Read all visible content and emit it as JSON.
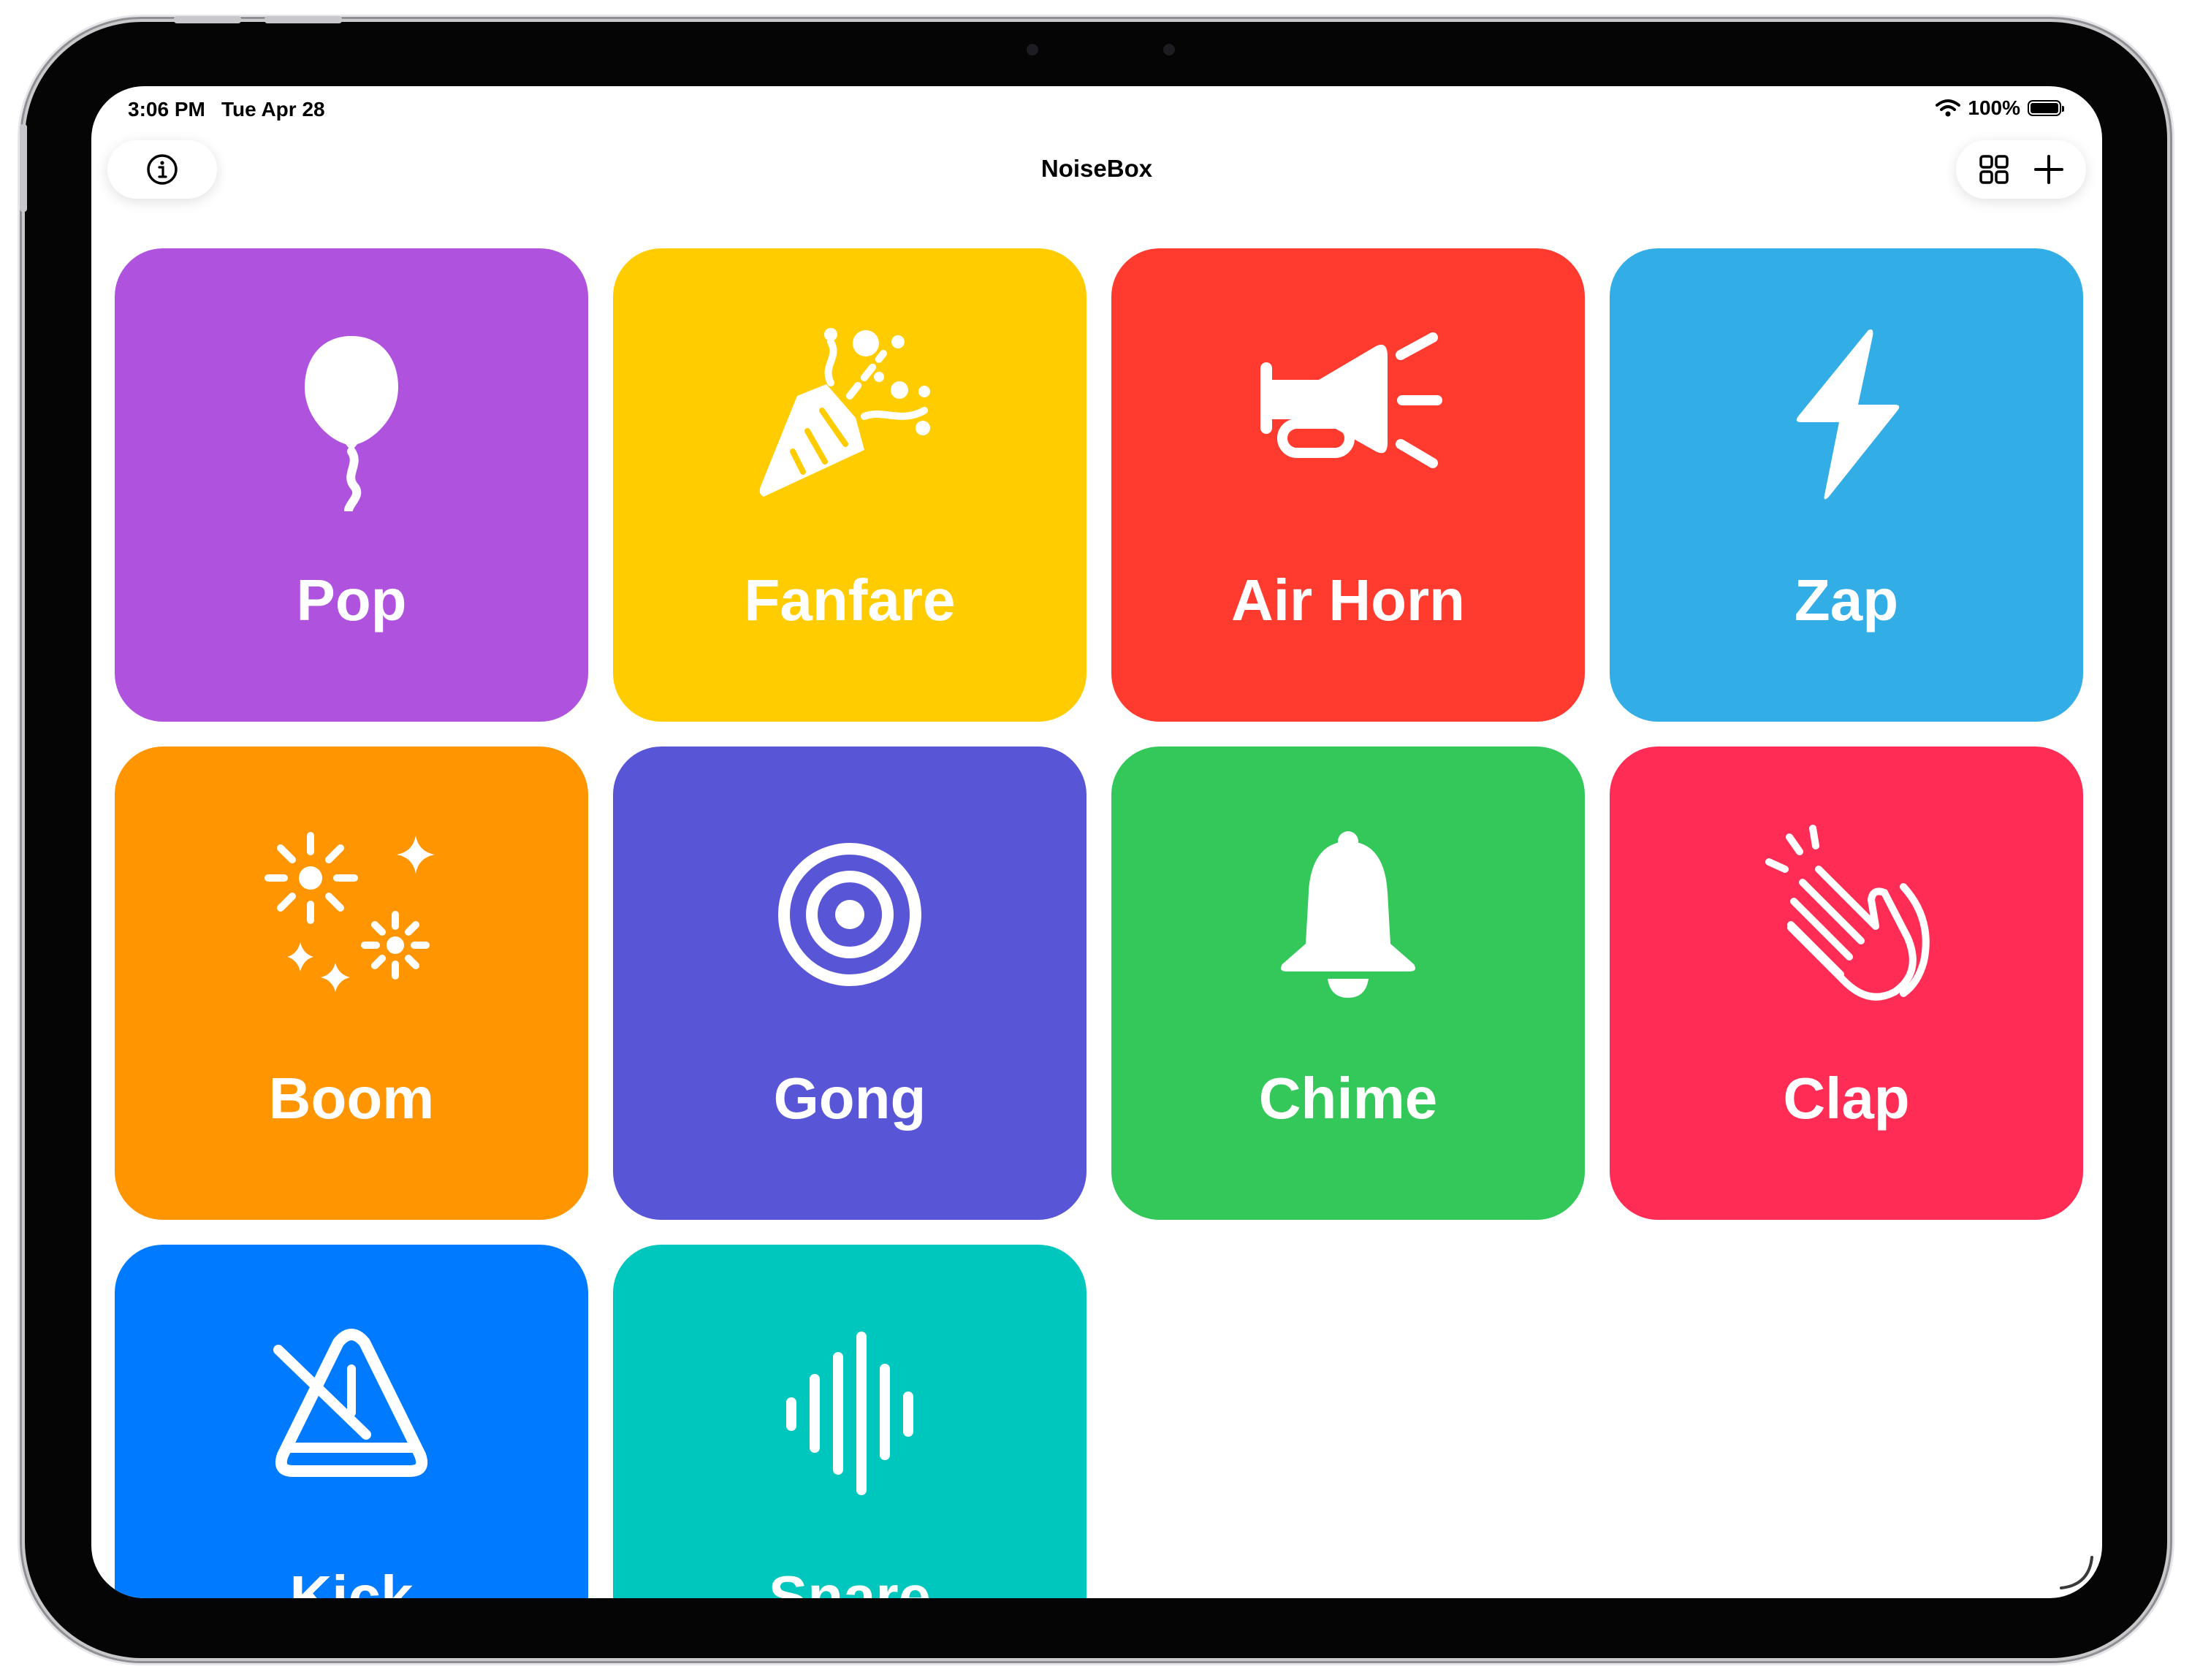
{
  "status_bar": {
    "time": "3:06 PM",
    "date": "Tue Apr 28",
    "battery": "100%",
    "battery_level": 1.0
  },
  "nav": {
    "title": "NoiseBox",
    "left_icon": "info-circle-icon",
    "right_icons": [
      "grid-icon",
      "plus-icon"
    ]
  },
  "tiles": [
    {
      "label": "Pop",
      "color": "#AF52DE",
      "icon": "balloon-icon"
    },
    {
      "label": "Fanfare",
      "color": "#FFCC00",
      "icon": "party-popper-icon"
    },
    {
      "label": "Air Horn",
      "color": "#FF3B30",
      "icon": "horn-icon"
    },
    {
      "label": "Zap",
      "color": "#32ADE6",
      "icon": "bolt-icon"
    },
    {
      "label": "Boom",
      "color": "#FF9500",
      "icon": "fireworks-icon"
    },
    {
      "label": "Gong",
      "color": "#5856D6",
      "icon": "target-icon"
    },
    {
      "label": "Chime",
      "color": "#34C759",
      "icon": "bell-icon"
    },
    {
      "label": "Clap",
      "color": "#FF2D55",
      "icon": "hands-clap-icon"
    },
    {
      "label": "Kick",
      "color": "#007AFF",
      "icon": "metronome-icon"
    },
    {
      "label": "Snare",
      "color": "#00C7BE",
      "icon": "waveform-icon"
    }
  ]
}
